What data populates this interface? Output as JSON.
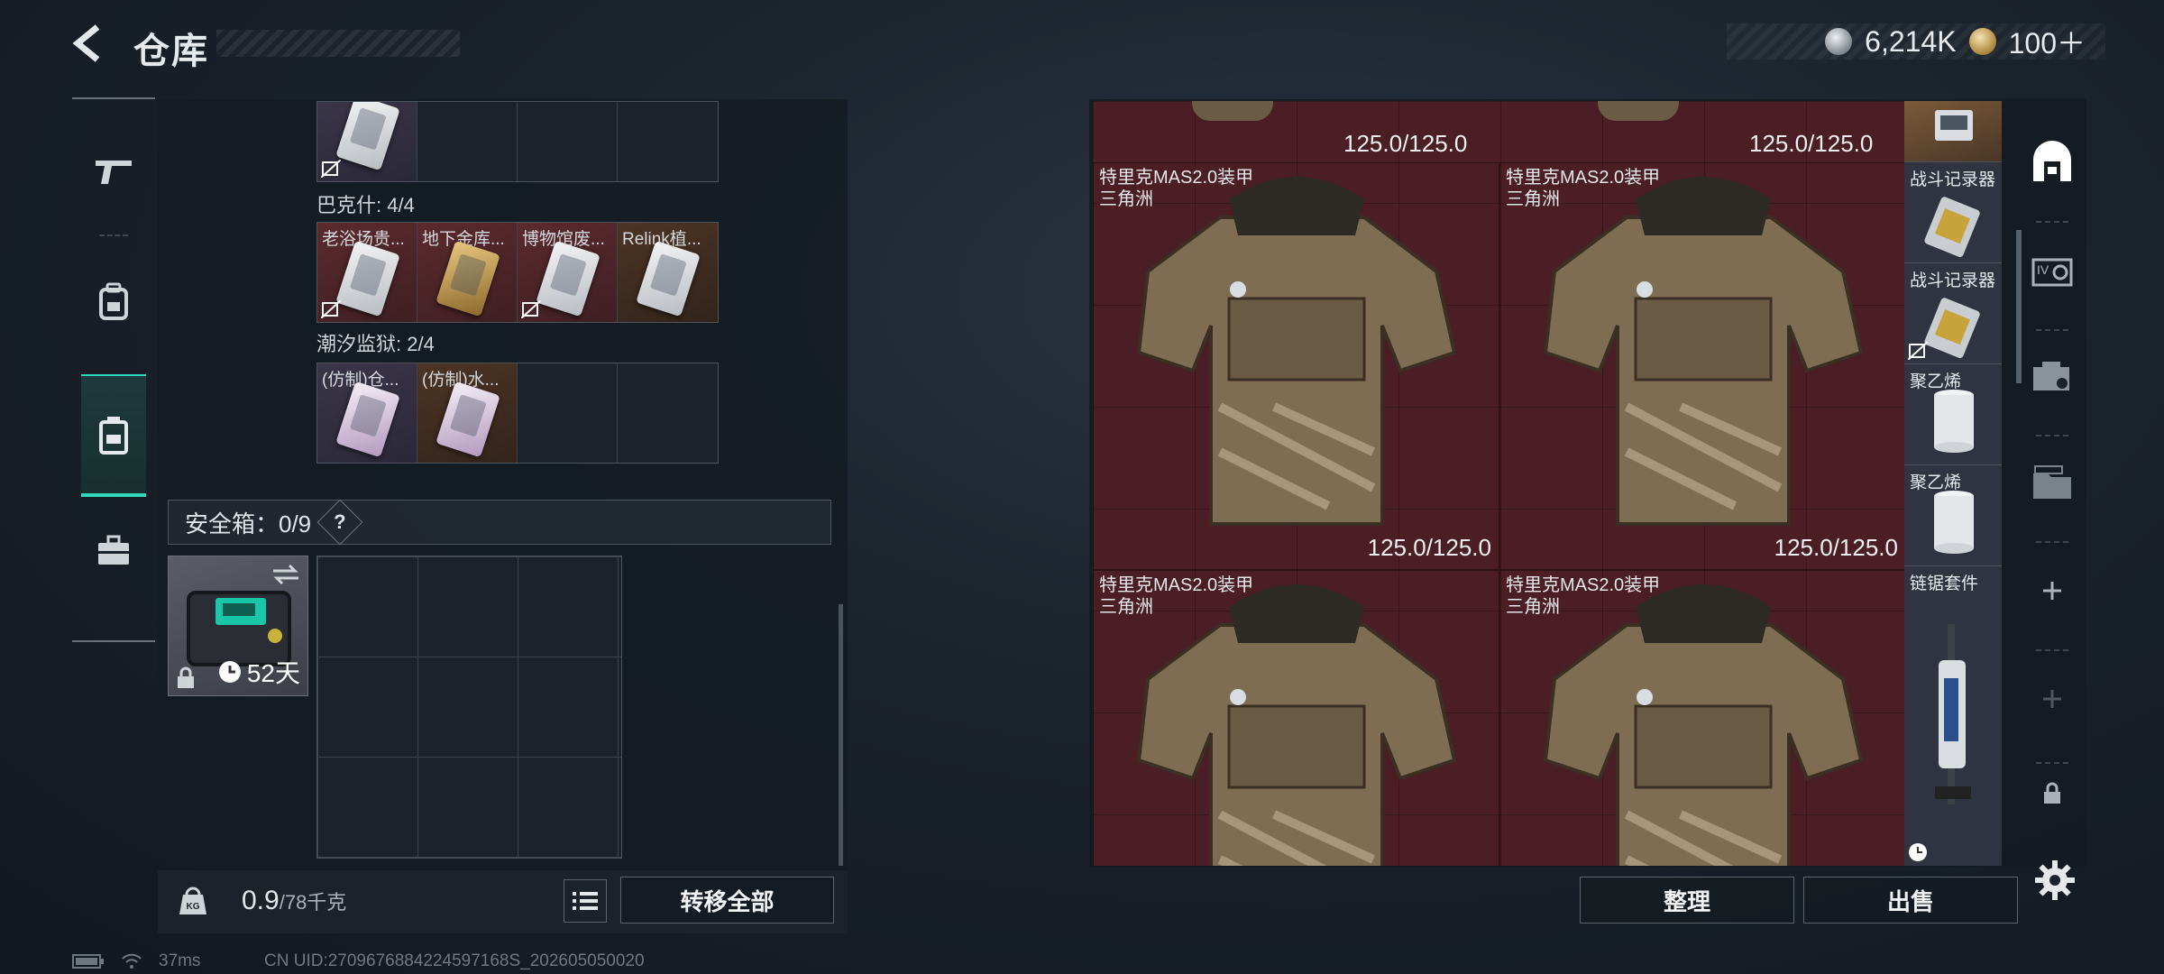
{
  "header": {
    "title": "仓库",
    "currency_silver": "6,214K",
    "currency_gold": "100＋"
  },
  "left_panel": {
    "sections": [
      {
        "label": "巴克什: 4/4",
        "items": [
          "老浴场贵...",
          "地下金库...",
          "博物馆废...",
          "Relink植..."
        ]
      },
      {
        "label": "潮汐监狱: 2/4",
        "items": [
          "(仿制)仓...",
          "(仿制)水..."
        ]
      }
    ],
    "safebox": {
      "label": "安全箱：0/9",
      "help": "?",
      "days": "52天"
    },
    "weight": {
      "current": "0.9",
      "max": "/78千克"
    },
    "transfer_all": "转移全部"
  },
  "stash": {
    "top_durability_1": "125.0/125.0",
    "top_durability_2": "125.0/125.0",
    "armors": [
      {
        "name": "特里克MAS2.0装甲",
        "map": "三角洲",
        "durability": "125.0/125.0"
      },
      {
        "name": "特里克MAS2.0装甲",
        "map": "三角洲",
        "durability": "125.0/125.0"
      },
      {
        "name": "特里克MAS2.0装甲",
        "map": "三角洲",
        "durability": ""
      },
      {
        "name": "特里克MAS2.0装甲",
        "map": "三角洲",
        "durability": ""
      }
    ],
    "side_items": [
      "战斗记录器",
      "战斗记录器",
      "聚乙烯",
      "聚乙烯",
      "链锯套件"
    ],
    "sort": "整理",
    "sell": "出售"
  },
  "status": {
    "ping": "37ms",
    "uid": "CN UID:2709676884224597168S_202605050020"
  },
  "colors": {
    "accent": "#2fd8b8",
    "stash_red": "#4a1e24"
  }
}
